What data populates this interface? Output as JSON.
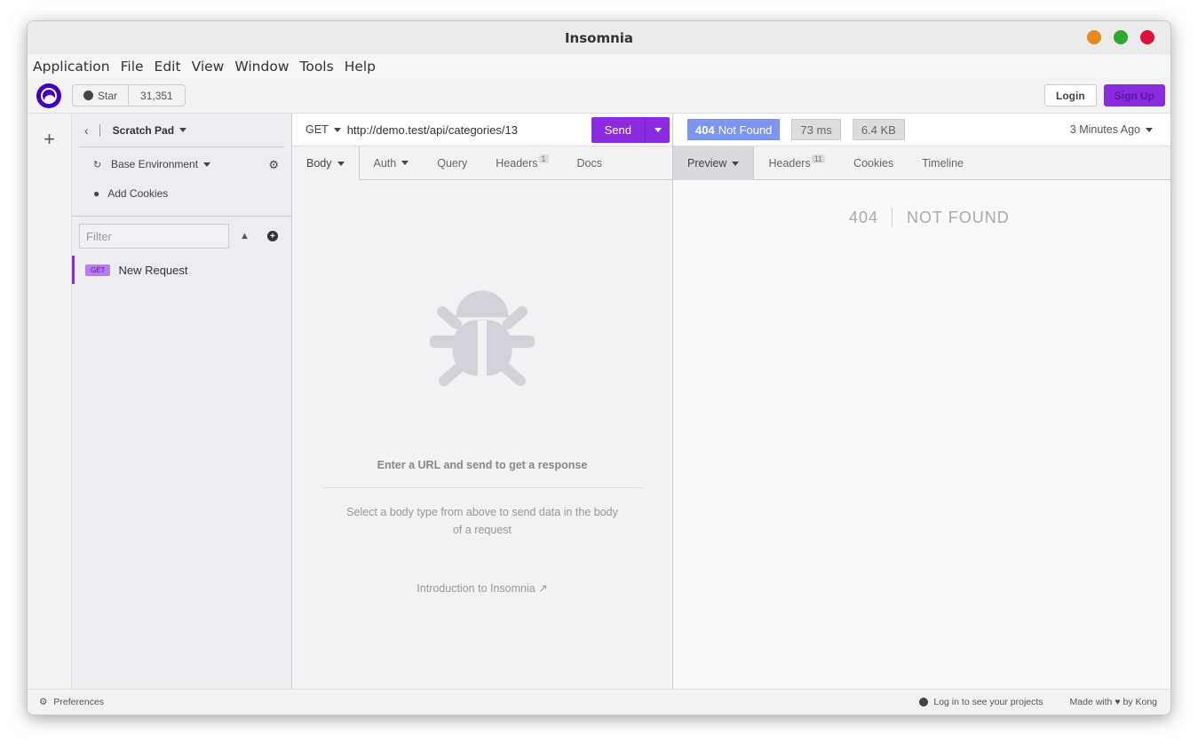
{
  "window": {
    "title": "Insomnia",
    "buttons": {
      "minimize": "#e8891c",
      "maximize": "#30a830",
      "close": "#e0123a"
    }
  },
  "menu": [
    "Application",
    "File",
    "Edit",
    "View",
    "Window",
    "Tools",
    "Help"
  ],
  "topbar": {
    "star_label": "Star",
    "star_count": "31,351",
    "login": "Login",
    "signup": "Sign Up"
  },
  "sidebar": {
    "project": "Scratch Pad",
    "environment": "Base Environment",
    "cookies": "Add Cookies",
    "filter_placeholder": "Filter",
    "requests": [
      {
        "method": "GET",
        "name": "New Request"
      }
    ]
  },
  "request": {
    "method": "GET",
    "url": "http://demo.test/api/categories/13",
    "send": "Send",
    "tabs": {
      "body": "Body",
      "auth": "Auth",
      "query": "Query",
      "headers": "Headers",
      "headers_count": "1",
      "docs": "Docs"
    },
    "empty_title": "Enter a URL and send to get a response",
    "empty_sub": "Select a body type from above to send data in the body of a request",
    "intro": "Introduction to Insomnia"
  },
  "response": {
    "status_code": "404",
    "status_text": "Not Found",
    "time": "73 ms",
    "size": "6.4 KB",
    "ago": "3 Minutes Ago",
    "tabs": {
      "preview": "Preview",
      "headers": "Headers",
      "headers_count": "11",
      "cookies": "Cookies",
      "timeline": "Timeline"
    },
    "body_code": "404",
    "body_msg": "NOT FOUND"
  },
  "statusbar": {
    "preferences": "Preferences",
    "login_prompt": "Log in to see your projects",
    "made_with_prefix": "Made with",
    "made_with_suffix": "by Kong"
  }
}
